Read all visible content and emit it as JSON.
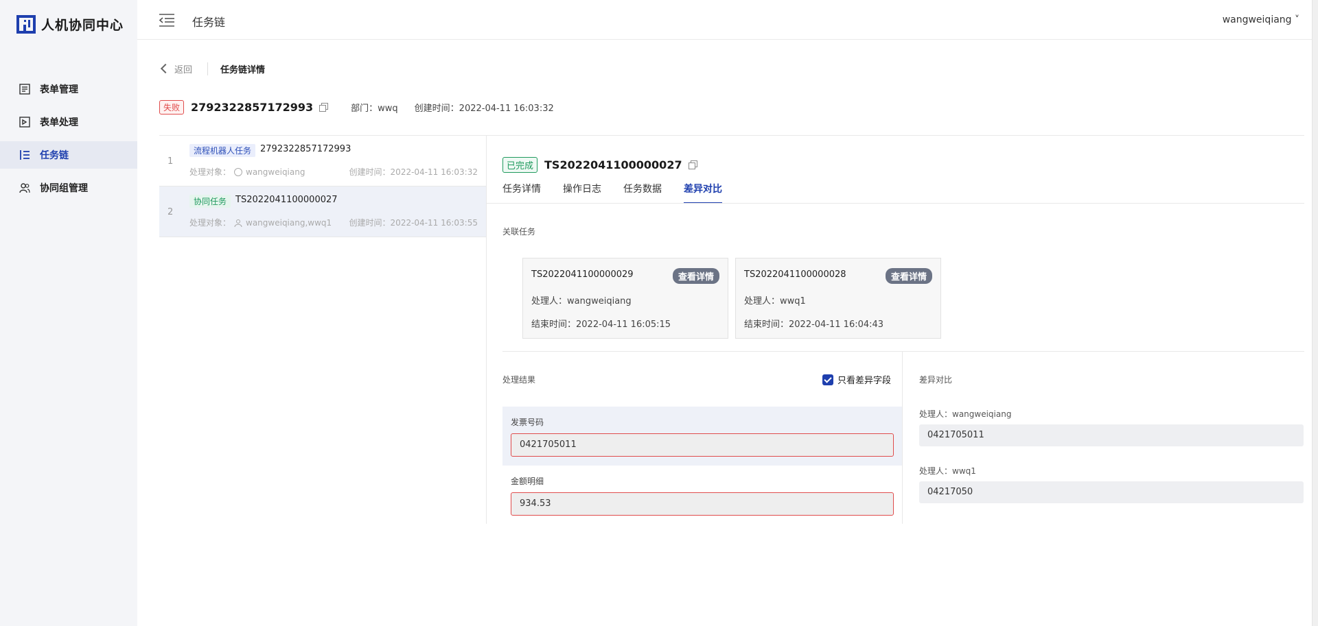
{
  "app": {
    "name": "人机协同中心"
  },
  "sidebar": {
    "items": [
      {
        "label": "表单管理",
        "icon": "form-list-icon"
      },
      {
        "label": "表单处理",
        "icon": "form-process-icon"
      },
      {
        "label": "任务链",
        "icon": "task-chain-icon",
        "active": true
      },
      {
        "label": "协同组管理",
        "icon": "group-icon"
      }
    ]
  },
  "header": {
    "title": "任务链",
    "user": "wangweiqiang ˅"
  },
  "breadcrumb": {
    "back": "返回",
    "current": "任务链详情"
  },
  "chain": {
    "status": "失败",
    "id": "2792322857172993",
    "dept": "部门：wwq",
    "created": "创建时间：2022-04-11 16:03:32"
  },
  "tasks": [
    {
      "num": "1",
      "tag": "流程机器人任务",
      "id": "2792322857172993",
      "handler": "处理对象：",
      "handler_name": "wangweiqiang",
      "created": "创建时间：2022-04-11 16:03:32"
    },
    {
      "num": "2",
      "tag": "协同任务",
      "id": "TS2022041100000027",
      "handler": "处理对象：",
      "handler_name": "wangweiqiang,wwq1",
      "created": "创建时间：2022-04-11 16:03:55"
    }
  ],
  "detail": {
    "status": "已完成",
    "id": "TS2022041100000027",
    "tabs": [
      "任务详情",
      "操作日志",
      "任务数据",
      "差异对比"
    ],
    "related_label": "关联任务",
    "related": [
      {
        "id": "TS2022041100000029",
        "button": "查看详情",
        "handler": "处理人：wangweiqiang",
        "end": "结束时间：2022-04-11 16:05:15"
      },
      {
        "id": "TS2022041100000028",
        "button": "查看详情",
        "handler": "处理人：wwq1",
        "end": "结束时间：2022-04-11 16:04:43"
      }
    ],
    "result_label": "处理结果",
    "only_diff": "只看差异字段",
    "fields": [
      {
        "label": "发票号码",
        "value": "0421705011"
      },
      {
        "label": "金额明细",
        "value": "934.53"
      }
    ],
    "compare_label": "差异对比",
    "compare": [
      {
        "label": "处理人：wangweiqiang",
        "value": "0421705011"
      },
      {
        "label": "处理人：wwq1",
        "value": "04217050"
      }
    ]
  },
  "colors": {
    "primary": "#1e3fae",
    "fail": "#e04b4b",
    "success": "#1f9a5d"
  }
}
